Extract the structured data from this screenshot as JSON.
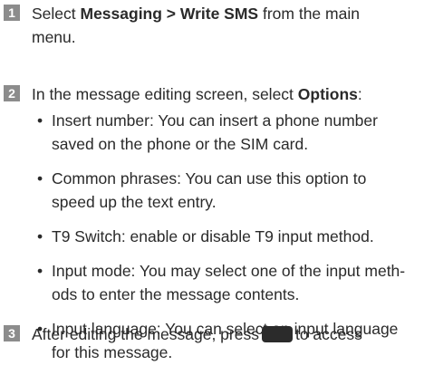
{
  "steps": [
    {
      "num": "1",
      "line1_pre": "Select ",
      "line1_bold": "Messaging > Write SMS",
      "line1_post": " from the main",
      "line2": "menu."
    },
    {
      "num": "2",
      "line1_pre": "In the message editing screen, select ",
      "line1_bold": "Options",
      "line1_post": ":",
      "bullets": [
        {
          "bullet": "•",
          "line1": "Insert number: You can insert a phone number",
          "line2": "saved on the phone or the SIM card."
        },
        {
          "bullet": "•",
          "line1": "Common phrases: You can use this option to",
          "line2": "speed up the text entry."
        },
        {
          "bullet": "•",
          "line1": "T9 Switch: enable or disable T9 input method.",
          "line2": ""
        },
        {
          "bullet": "•",
          "line1": "Input mode: You may select one of the input meth-",
          "line2": "ods to enter the message contents."
        },
        {
          "bullet": "•",
          "line1": "Input language: You can select an input language",
          "line2": "for this message."
        }
      ]
    },
    {
      "num": "3",
      "line1_pre": "After editing the message, press",
      "key_icon": "softkey-icon",
      "line1_post": "to access"
    }
  ]
}
